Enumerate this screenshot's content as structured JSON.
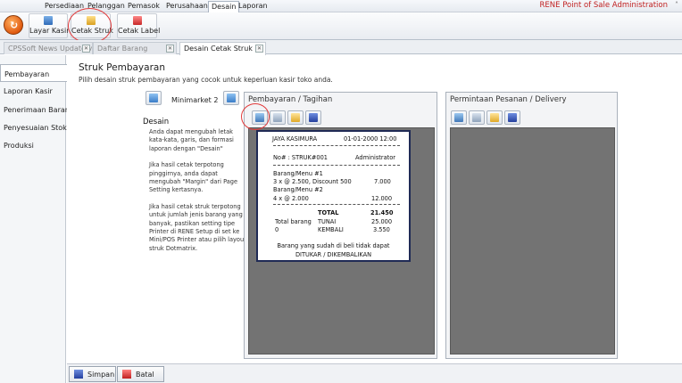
{
  "menu": {
    "items": [
      "Persediaan",
      "Pelanggan",
      "Pemasok",
      "Perusahaan",
      "Desain",
      "Laporan"
    ],
    "active": "Desain",
    "app_title": "RENE Point of Sale Administration"
  },
  "ribbon": {
    "buttons": [
      {
        "label": "Layar Kasir",
        "icon": "cashier-screen-icon"
      },
      {
        "label": "Cetak Struk",
        "icon": "print-receipt-icon"
      },
      {
        "label": "Cetak Label",
        "icon": "print-label-icon"
      }
    ]
  },
  "tabs": [
    {
      "label": "CPSSoft News Update v...",
      "active": false
    },
    {
      "label": "Daftar Barang",
      "active": false
    },
    {
      "label": "Desain Cetak Struk",
      "active": true
    }
  ],
  "sidebar": {
    "items": [
      "Pembayaran",
      "Laporan Kasir",
      "Penerimaan Barang",
      "Penyesuaian Stok",
      "Produksi"
    ],
    "active": "Pembayaran"
  },
  "page": {
    "title": "Struk Pembayaran",
    "subtitle": "Pilih desain struk pembayaran yang cocok untuk keperluan kasir toko anda.",
    "nav_label": "Minimarket 2",
    "desain_title": "Desain",
    "desain_p1": "Anda dapat mengubah letak kata-kata, garis, dan formasi laporan dengan \"Desain\"",
    "desain_p2": "Jika hasil cetak terpotong pinggirnya, anda dapat mengubah \"Margin\" dari Page Setting kertasnya.",
    "desain_p3": "Jika hasil cetak struk terpotong untuk jumlah jenis barang yang banyak, pastikan setting tipe Printer di RENE Setup di set ke Mini/POS Printer atau pilih layout struk Dotmatrix."
  },
  "panels": {
    "left_title": "Pembayaran / Tagihan",
    "right_title": "Permintaan Pesanan / Delivery"
  },
  "receipt": {
    "store": "JAYA KASIMURA",
    "datetime": "01-01-2000  12:00",
    "no": "No# : STRUK#001",
    "cashier": "Administrator",
    "item1_name": "Barang/Menu #1",
    "item1_detail": "3 x @ 2.500, Discount 500",
    "item1_total": "7.000",
    "item2_name": "Barang/Menu #2",
    "item2_detail": "4 x @ 2.000",
    "item2_total": "12.000",
    "total_label": "TOTAL",
    "total_value": "21.450",
    "total_barang_label": "Total barang",
    "tunai_label": "TUNAI",
    "tunai_value": "25.000",
    "total_barang_value": "0",
    "kembali_label": "KEMBALI",
    "kembali_value": "3.550",
    "footer": "Barang  yang sudah di beli tidak dapat DITUKAR / DIKEMBALIKAN"
  },
  "bottom": {
    "save_label": "Simpan",
    "cancel_label": "Batal"
  },
  "colors": {
    "accent_red": "#e23b3b",
    "receipt_border": "#1f2a55",
    "preview_gray": "#737373"
  }
}
